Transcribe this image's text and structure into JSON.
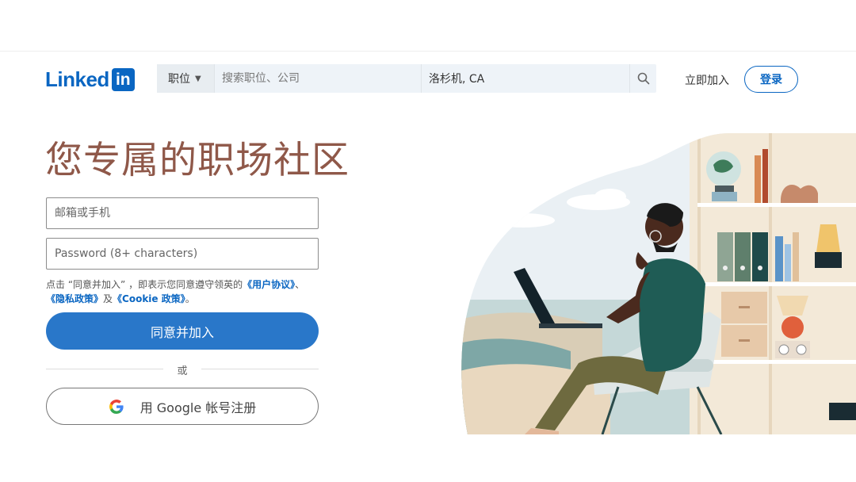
{
  "header": {
    "logo_text": "Linked",
    "logo_in": "in",
    "job_select_label": "职位",
    "search_placeholder": "搜索职位、公司",
    "location_value": "洛杉机, CA",
    "join_link": "立即加入",
    "signin_button": "登录"
  },
  "main": {
    "title": "您专属的职场社区",
    "email_placeholder": "邮箱或手机",
    "password_placeholder": "Password (8+ characters)",
    "agreement": {
      "prefix": "点击 “同意并加入” ，即表示您同意遵守领英的",
      "user_agreement": "《用户协议》",
      "sep1": "、",
      "privacy_policy": "《隐私政策》",
      "sep2": "及",
      "cookie_policy": "《Cookie 政策》",
      "suffix": "。"
    },
    "join_button": "同意并加入",
    "or_text": "或",
    "google_button": "用 Google 帐号注册"
  },
  "icons": {
    "caret": "caret-down-icon",
    "search": "search-icon",
    "google": "google-icon"
  },
  "colors": {
    "brand": "#0a66c2",
    "primary_button": "#2977c9",
    "title": "#8f5849"
  }
}
